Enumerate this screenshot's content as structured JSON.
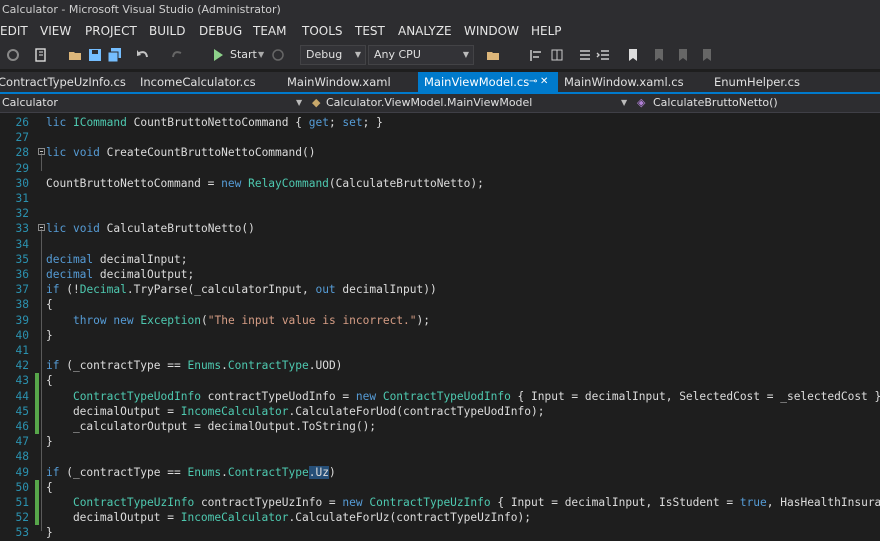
{
  "window": {
    "title": "Calculator - Microsoft Visual Studio (Administrator)"
  },
  "menu": [
    "EDIT",
    "VIEW",
    "PROJECT",
    "BUILD",
    "DEBUG",
    "TEAM",
    "TOOLS",
    "TEST",
    "ANALYZE",
    "WINDOW",
    "HELP"
  ],
  "toolbar": {
    "start_label": "Start",
    "config": "Debug",
    "platform": "Any CPU"
  },
  "tabs": [
    {
      "label": "ContractTypeUzInfo.cs",
      "active": false
    },
    {
      "label": "IncomeCalculator.cs",
      "active": false
    },
    {
      "label": "MainWindow.xaml",
      "active": false
    },
    {
      "label": "MainViewModel.cs",
      "active": true
    },
    {
      "label": "MainWindow.xaml.cs",
      "active": false
    },
    {
      "label": "EnumHelper.cs",
      "active": false
    }
  ],
  "navbar": {
    "project": "Calculator",
    "type": "Calculator.ViewModel.MainViewModel",
    "member": "CalculateBruttoNetto()"
  },
  "colors": {
    "accent": "#007acc",
    "keyword": "#569cd6",
    "type": "#4ec9b0",
    "string": "#d69d85",
    "line_number": "#2b91af",
    "changed_margin": "#57a64a"
  },
  "code_lines": [
    {
      "n": "26",
      "code": "lic ICommand CountBruttoNettoCommand { get; set; }"
    },
    {
      "n": "27",
      "code": ""
    },
    {
      "n": "28",
      "code": "lic void CreateCountBruttoNettoCommand()"
    },
    {
      "n": "29",
      "code": ""
    },
    {
      "n": "30",
      "code": "CountBruttoNettoCommand = new RelayCommand(CalculateBruttoNetto);"
    },
    {
      "n": "31",
      "code": ""
    },
    {
      "n": "32",
      "code": ""
    },
    {
      "n": "33",
      "code": "lic void CalculateBruttoNetto()"
    },
    {
      "n": "34",
      "code": ""
    },
    {
      "n": "35",
      "code": "decimal decimalInput;"
    },
    {
      "n": "36",
      "code": "decimal decimalOutput;"
    },
    {
      "n": "37",
      "code": "if (!Decimal.TryParse(_calculatorInput, out decimalInput))"
    },
    {
      "n": "38",
      "code": "{"
    },
    {
      "n": "39",
      "code": "    throw new Exception(\"The input value is incorrect.\");"
    },
    {
      "n": "40",
      "code": "}"
    },
    {
      "n": "41",
      "code": ""
    },
    {
      "n": "42",
      "code": "if (_contractType == Enums.ContractType.UOD)"
    },
    {
      "n": "43",
      "code": "{"
    },
    {
      "n": "44",
      "code": "    ContractTypeUodInfo contractTypeUodInfo = new ContractTypeUodInfo { Input = decimalInput, SelectedCost = _selectedCost };"
    },
    {
      "n": "45",
      "code": "    decimalOutput = IncomeCalculator.CalculateForUod(contractTypeUodInfo);"
    },
    {
      "n": "46",
      "code": "    _calculatorOutput = decimalOutput.ToString();"
    },
    {
      "n": "47",
      "code": "}"
    },
    {
      "n": "48",
      "code": ""
    },
    {
      "n": "49",
      "code": "if (_contractType == Enums.ContractType.Uz)"
    },
    {
      "n": "50",
      "code": "{"
    },
    {
      "n": "51",
      "code": "    ContractTypeUzInfo contractTypeUzInfo = new ContractTypeUzInfo { Input = decimalInput, IsStudent = true, HasHealthInsurance"
    },
    {
      "n": "52",
      "code": "    decimalOutput = IncomeCalculator.CalculateForUz(contractTypeUzInfo);"
    },
    {
      "n": "53",
      "code": "}"
    }
  ]
}
